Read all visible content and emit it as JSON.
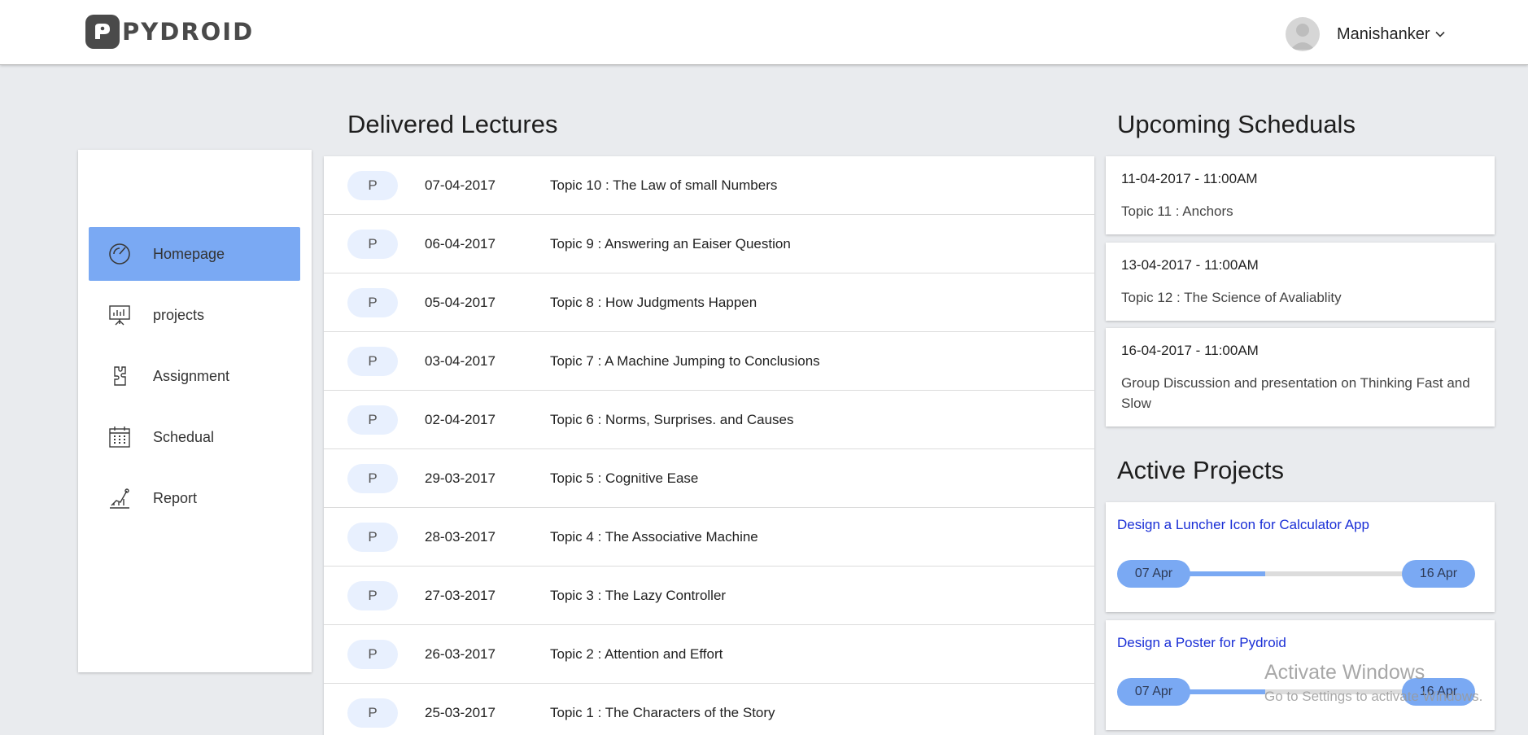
{
  "header": {
    "logo_text": "PYDROID",
    "user_name": "Manishanker"
  },
  "sidebar": {
    "items": [
      {
        "label": "Homepage",
        "icon": "dashboard-gauge-icon",
        "active": true
      },
      {
        "label": "projects",
        "icon": "presentation-chart-icon",
        "active": false
      },
      {
        "label": "Assignment",
        "icon": "puzzle-piece-icon",
        "active": false
      },
      {
        "label": "Schedual",
        "icon": "calendar-icon",
        "active": false
      },
      {
        "label": "Report",
        "icon": "growth-chart-icon",
        "active": false
      }
    ]
  },
  "lectures": {
    "title": "Delivered Lectures",
    "rows": [
      {
        "badge": "P",
        "date": "07-04-2017",
        "topic": "Topic 10 : The Law of small Numbers"
      },
      {
        "badge": "P",
        "date": "06-04-2017",
        "topic": "Topic 9 : Answering an Eaiser Question"
      },
      {
        "badge": "P",
        "date": "05-04-2017",
        "topic": "Topic 8 : How Judgments Happen"
      },
      {
        "badge": "P",
        "date": "03-04-2017",
        "topic": "Topic 7 : A Machine Jumping to Conclusions"
      },
      {
        "badge": "P",
        "date": "02-04-2017",
        "topic": "Topic 6 : Norms, Surprises. and Causes"
      },
      {
        "badge": "P",
        "date": "29-03-2017",
        "topic": "Topic 5 : Cognitive Ease"
      },
      {
        "badge": "P",
        "date": "28-03-2017",
        "topic": "Topic 4 : The Associative Machine"
      },
      {
        "badge": "P",
        "date": "27-03-2017",
        "topic": "Topic 3 : The Lazy Controller"
      },
      {
        "badge": "P",
        "date": "26-03-2017",
        "topic": "Topic 2 : Attention and Effort"
      },
      {
        "badge": "P",
        "date": "25-03-2017",
        "topic": "Topic 1 : The Characters of the Story"
      }
    ]
  },
  "schedules": {
    "title": "Upcoming Scheduals",
    "items": [
      {
        "datetime": "11-04-2017 - 11:00AM",
        "topic": "Topic 11 : Anchors"
      },
      {
        "datetime": "13-04-2017 - 11:00AM",
        "topic": "Topic 12 : The Science of Avaliablity"
      },
      {
        "datetime": "16-04-2017 - 11:00AM",
        "topic": "Group Discussion and presentation on Thinking Fast and Slow"
      }
    ]
  },
  "projects": {
    "title": "Active Projects",
    "items": [
      {
        "title": "Design a Luncher Icon for Calculator App",
        "start": "07 Apr",
        "end": "16 Apr",
        "progress": 0.4
      },
      {
        "title": "Design a Poster for Pydroid",
        "start": "07 Apr",
        "end": "16 Apr",
        "progress": 0.4
      }
    ]
  },
  "watermark": {
    "line1": "Activate Windows",
    "line2": "Go to Settings to activate Windows."
  },
  "colors": {
    "background": "#e9ebee",
    "accent": "#7aa9f3",
    "pill_bg": "#e8f0fe",
    "link": "#1a2fd6"
  }
}
